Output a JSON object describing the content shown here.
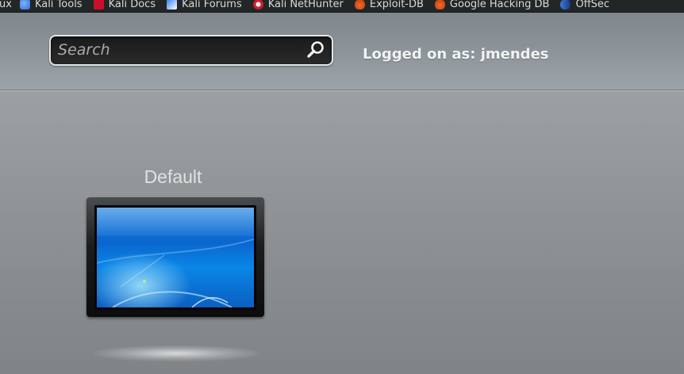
{
  "bookmarks": [
    {
      "label": "ux",
      "icon": "none"
    },
    {
      "label": "Kali Tools",
      "icon": "kali-tools-icon"
    },
    {
      "label": "Kali Docs",
      "icon": "kali-docs-icon"
    },
    {
      "label": "Kali Forums",
      "icon": "kali-forums-icon"
    },
    {
      "label": "Kali NetHunter",
      "icon": "kali-nethunter-icon"
    },
    {
      "label": "Exploit-DB",
      "icon": "exploit-db-icon"
    },
    {
      "label": "Google Hacking DB",
      "icon": "exploit-db-icon"
    },
    {
      "label": "OffSec",
      "icon": "offsec-icon"
    }
  ],
  "header": {
    "search": {
      "placeholder": "Search",
      "value": ""
    },
    "logged_in": "Logged on as: jmendes"
  },
  "desktops": [
    {
      "label": "Default"
    }
  ],
  "colors": {
    "background": "#9a9ea1",
    "header": "#8b9398",
    "search_box": "#1f1f1f",
    "screen_blue": "#0a66cf"
  }
}
